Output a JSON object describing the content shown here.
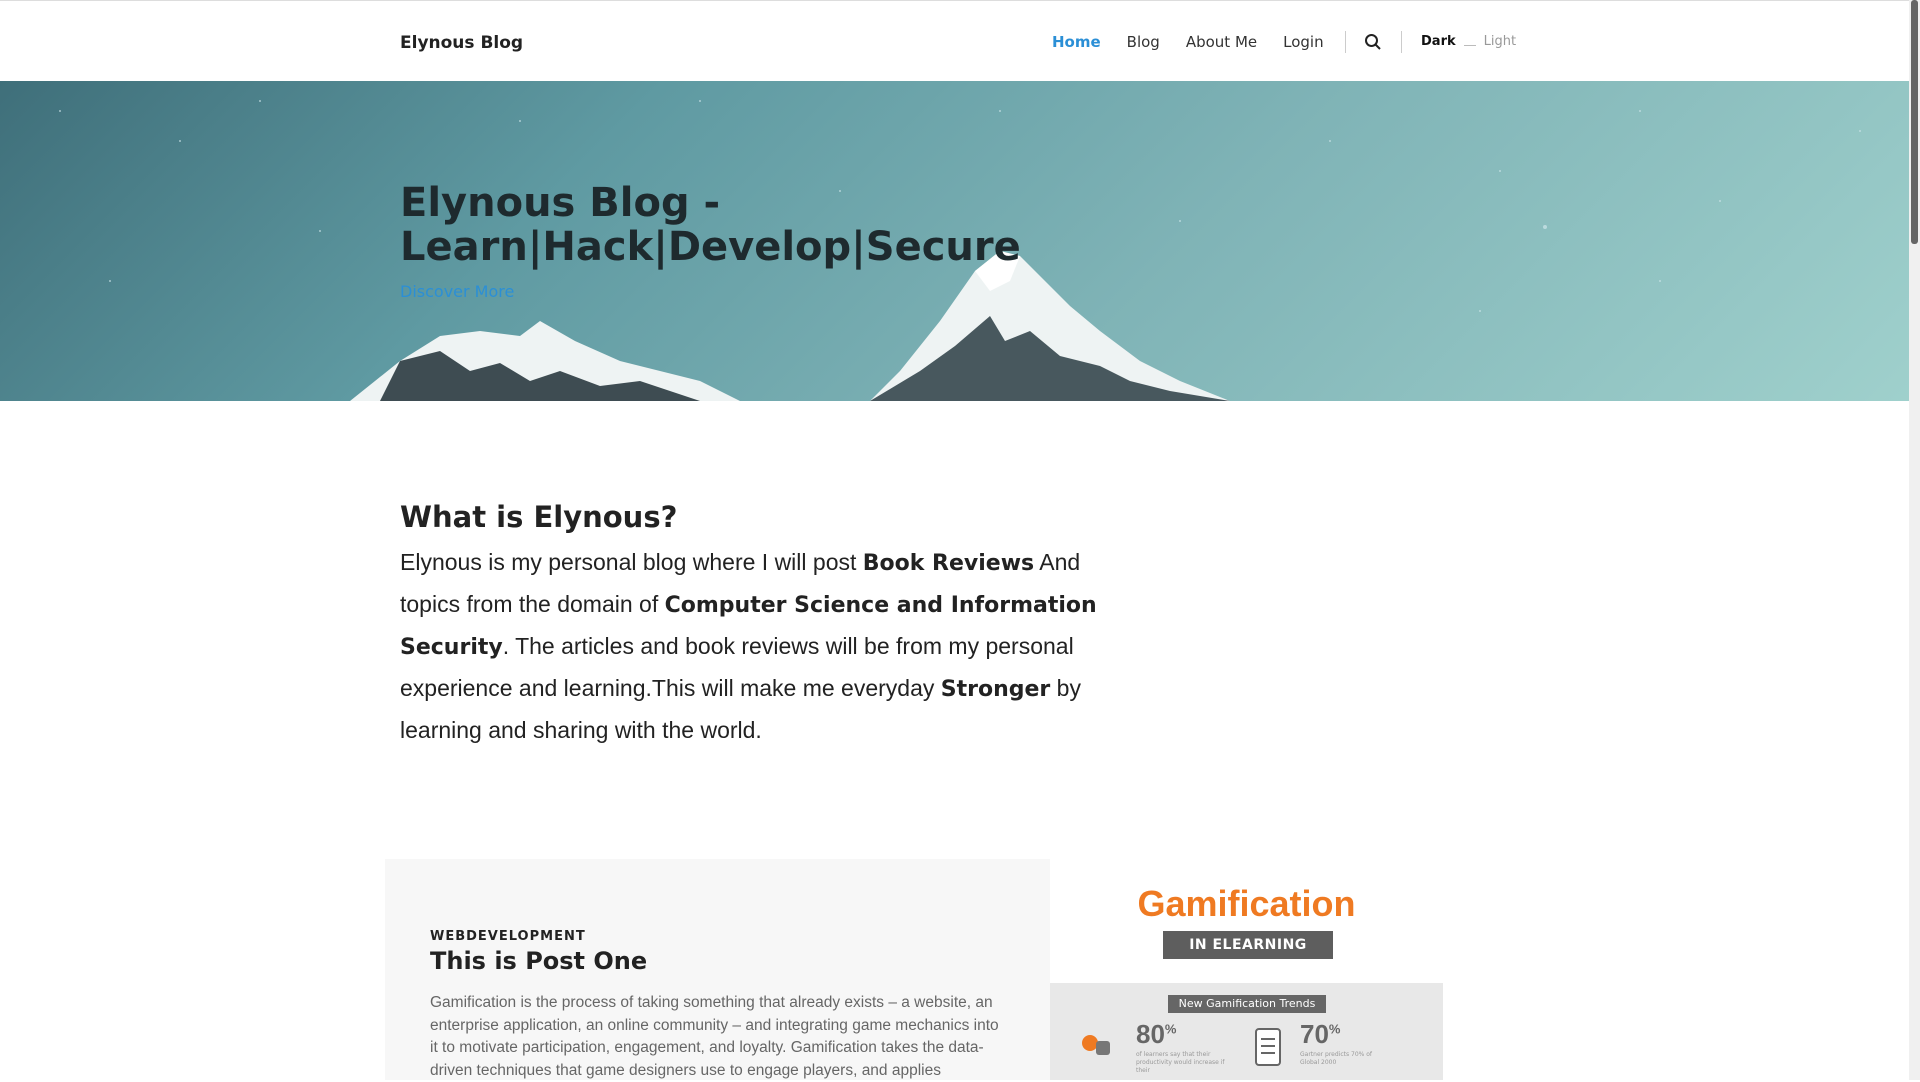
{
  "header": {
    "brand": "Elynous Blog",
    "nav": [
      {
        "label": "Home",
        "active": true
      },
      {
        "label": "Blog"
      },
      {
        "label": "About Me"
      },
      {
        "label": "Login"
      }
    ],
    "search_icon": "search-icon",
    "theme": {
      "dark_label": "Dark",
      "light_label": "Light"
    },
    "accent_color": "#2b8fd6"
  },
  "hero": {
    "title_line1": "Elynous Blog -",
    "title_line2": "Learn|Hack|Develop|Secure",
    "link_label": "Discover More"
  },
  "about": {
    "title": "What is Elynous?",
    "p1": "Elynous is my personal blog where I will post ",
    "b1": "Book Reviews",
    "p2": " And topics from the domain of ",
    "b2": "Computer Science and Information Security",
    "p3": ". The articles and book reviews will be from my personal experience and learning.This will make me everyday ",
    "b3": "Stronger",
    "p4": " by learning and sharing with the world."
  },
  "post": {
    "category": "WEBDEVELOPMENT",
    "title": "This is Post One",
    "excerpt": "Gamification is the process of taking something that already exists – a website, an enterprise application, an online community – and integrating game mechanics into it to motivate participation, engagement, and loyalty. Gamification takes the data-driven techniques that game designers use to engage players, and applies",
    "image": {
      "title": "Gamification",
      "ribbon": "IN ELEARNING",
      "subtitle": "New Gamification Trends",
      "stat1": "80",
      "stat1_note": "of learners say that their productivity would increase if their",
      "stat2": "70",
      "stat2_note": "Gartner predicts 70% of Global 2000",
      "percent": "%",
      "accent_color": "#ef7a22"
    }
  }
}
